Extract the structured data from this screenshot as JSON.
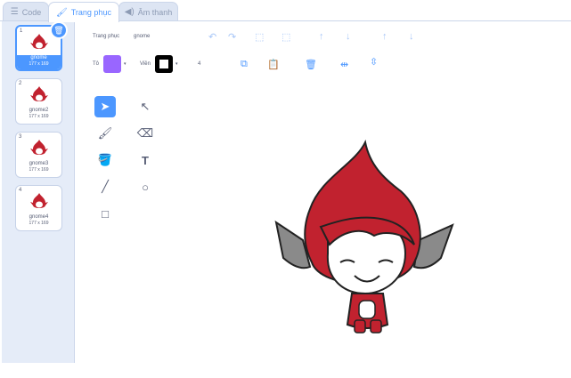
{
  "tabs": [
    {
      "label": "Code",
      "icon": "code-icon"
    },
    {
      "label": "Trang phục",
      "icon": "brush-icon"
    },
    {
      "label": "Âm thanh",
      "icon": "speaker-icon"
    }
  ],
  "costumes": [
    {
      "number": "1",
      "name": "gnome",
      "size": "177 x 169"
    },
    {
      "number": "2",
      "name": "gnome2",
      "size": "177 x 169"
    },
    {
      "number": "3",
      "name": "gnome3",
      "size": "177 x 169"
    },
    {
      "number": "4",
      "name": "gnome4",
      "size": "177 x 169"
    }
  ],
  "toolbar": {
    "costume_label": "Trang phục",
    "costume_name": "gnome",
    "fill_label": "Tô",
    "outline_label": "Viền",
    "outline_width": "4",
    "fill_color": "#9966ff",
    "outline_color": "#000000"
  },
  "accent": "#4c97ff"
}
